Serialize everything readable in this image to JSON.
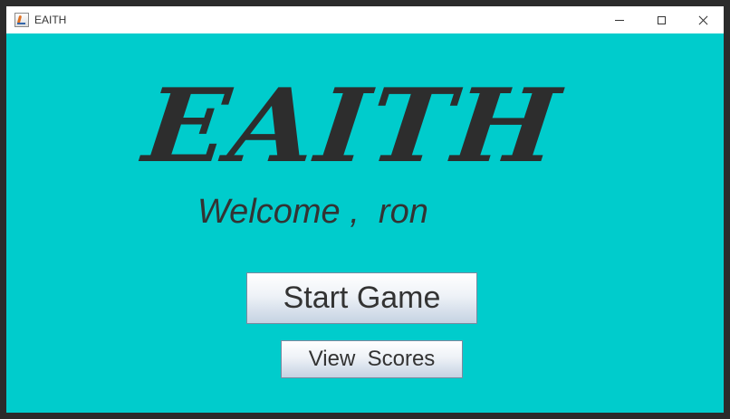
{
  "window": {
    "title": "EAITH",
    "controls": [
      "minimize",
      "maximize",
      "close"
    ]
  },
  "colors": {
    "background": "#00cccc",
    "text": "#333333"
  },
  "logo": {
    "text": "EAITH"
  },
  "welcome": {
    "text": "Welcome ,  ron"
  },
  "buttons": {
    "start_game": "Start Game",
    "view_scores": "View  Scores"
  }
}
